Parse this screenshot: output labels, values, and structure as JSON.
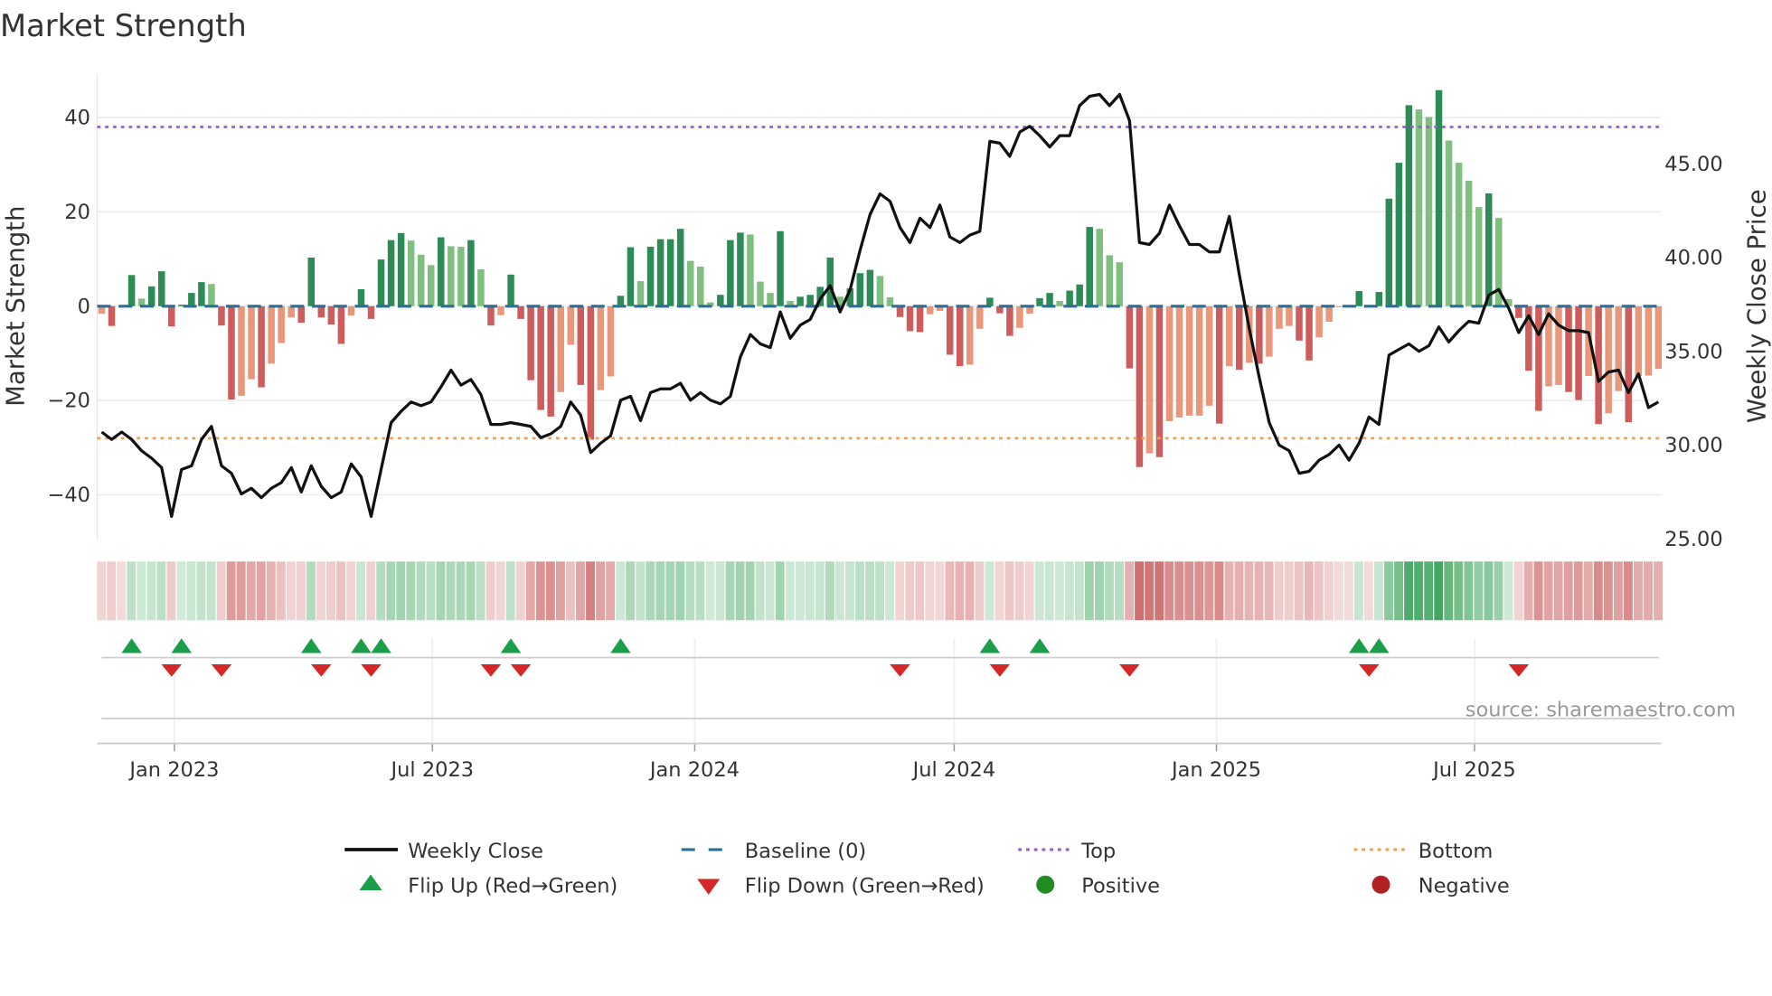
{
  "title": "Market Strength",
  "source": "source: sharemaestro.com",
  "legend": {
    "weekly_close": "Weekly Close",
    "baseline": "Baseline (0)",
    "top": "Top",
    "bottom": "Bottom",
    "flip_up": "Flip Up (Red→Green)",
    "flip_down": "Flip Down (Green→Red)",
    "positive": "Positive",
    "negative": "Negative"
  },
  "colors": {
    "pos_rising": "#2e8b57",
    "pos_falling": "#7fbf7f",
    "neg_falling": "#cd5c5c",
    "neg_rising": "#e9967a",
    "baseline": "#2a6f97",
    "top": "#9b59d6",
    "bottom": "#f0a050",
    "close": "#111111",
    "flip_up": "#1a9e4a",
    "flip_down": "#d62728",
    "positive": "#228b22",
    "negative": "#b22222"
  },
  "chart_data": {
    "type": "bar+line",
    "title": "Market Strength",
    "ylabel_left": "Market Strength",
    "ylabel_right": "Weekly Close Price",
    "ylim_left": [
      -49.5,
      49.5
    ],
    "ylim_right": [
      24.9,
      49.8
    ],
    "left_ticks": [
      {
        "v": 40,
        "label": "40"
      },
      {
        "v": 20,
        "label": "20"
      },
      {
        "v": 0,
        "label": "0"
      },
      {
        "v": -20,
        "label": "−20"
      },
      {
        "v": -40,
        "label": "−40"
      }
    ],
    "right_ticks": [
      {
        "v": 45,
        "label": "45.00"
      },
      {
        "v": 40,
        "label": "40.00"
      },
      {
        "v": 35,
        "label": "35.00"
      },
      {
        "v": 30,
        "label": "30.00"
      },
      {
        "v": 25,
        "label": "25.00"
      }
    ],
    "x_start_week": "2022-11-11",
    "x_ticks": [
      {
        "date": "2023-01-01",
        "label": "Jan 2023"
      },
      {
        "date": "2023-07-01",
        "label": "Jul 2023"
      },
      {
        "date": "2024-01-01",
        "label": "Jan 2024"
      },
      {
        "date": "2024-07-01",
        "label": "Jul 2024"
      },
      {
        "date": "2025-01-01",
        "label": "Jan 2025"
      },
      {
        "date": "2025-07-01",
        "label": "Jul 2025"
      }
    ],
    "top_level": 38,
    "bottom_level": -28,
    "baseline": 0,
    "grid": true,
    "legend_position": "bottom",
    "strength": [
      -1.6,
      -4.2,
      -0.2,
      6.6,
      1.6,
      4.2,
      7.4,
      -4.3,
      0.3,
      2.8,
      5.1,
      4.7,
      -4.1,
      -19.8,
      -19.0,
      -15.5,
      -17.2,
      -12.2,
      -7.8,
      -2.4,
      -3.5,
      10.3,
      -2.4,
      -3.9,
      -8.0,
      -2.0,
      3.6,
      -2.7,
      9.9,
      14.0,
      15.5,
      13.9,
      10.9,
      8.7,
      14.6,
      12.7,
      12.6,
      14.0,
      7.8,
      -4.1,
      -1.9,
      6.7,
      -2.7,
      -15.7,
      -22.0,
      -23.4,
      -18.2,
      -8.2,
      -16.7,
      -28.3,
      -17.8,
      -14.9,
      2.2,
      12.5,
      5.3,
      12.6,
      14.2,
      14.2,
      16.4,
      9.6,
      8.4,
      0.8,
      2.4,
      14.0,
      15.6,
      15.2,
      5.2,
      2.8,
      15.9,
      1.1,
      2.0,
      2.4,
      4.1,
      10.3,
      2.0,
      3.8,
      7.0,
      7.7,
      6.4,
      1.9,
      -2.3,
      -5.3,
      -5.5,
      -1.7,
      -1.0,
      -10.3,
      -12.7,
      -12.4,
      -4.8,
      1.8,
      -1.5,
      -6.3,
      -4.6,
      -1.6,
      1.7,
      2.8,
      1.1,
      3.3,
      4.6,
      16.8,
      16.4,
      10.8,
      9.3,
      -13.2,
      -34.1,
      -31.2,
      -32.0,
      -24.4,
      -23.6,
      -23.2,
      -23.2,
      -21.1,
      -24.9,
      -12.7,
      -13.5,
      -12.0,
      -12.2,
      -10.7,
      -4.8,
      -4.2,
      -7.3,
      -11.5,
      -6.6,
      -3.3,
      -0.2,
      -0.1,
      3.2,
      -0.1,
      3.0,
      22.8,
      30.4,
      42.6,
      41.7,
      40.1,
      45.8,
      35.1,
      30.4,
      26.6,
      21.0,
      23.9,
      18.7,
      1.5,
      -2.5,
      -13.7,
      -22.2,
      -17.0,
      -16.7,
      -18.2,
      -19.9,
      -14.8,
      -25.0,
      -22.7,
      -18.0,
      -24.6,
      -14.8,
      -14.7,
      -13.3
    ],
    "weekly_close": [
      30.7,
      30.3,
      30.7,
      30.3,
      29.7,
      29.3,
      28.8,
      26.2,
      28.7,
      28.9,
      30.3,
      31.0,
      28.9,
      28.5,
      27.4,
      27.7,
      27.2,
      27.7,
      28.0,
      28.8,
      27.5,
      28.9,
      27.8,
      27.2,
      27.5,
      29.0,
      28.3,
      26.2,
      28.7,
      31.2,
      31.8,
      32.3,
      32.1,
      32.3,
      33.1,
      34.0,
      33.2,
      33.5,
      32.7,
      31.1,
      31.1,
      31.2,
      31.1,
      31.0,
      30.4,
      30.6,
      31.0,
      32.3,
      31.6,
      29.6,
      30.1,
      30.5,
      32.4,
      32.6,
      31.3,
      32.8,
      33.0,
      33.0,
      33.3,
      32.4,
      32.8,
      32.4,
      32.2,
      32.6,
      34.7,
      35.9,
      35.4,
      35.2,
      37.1,
      35.7,
      36.4,
      36.7,
      37.8,
      38.5,
      37.1,
      38.3,
      40.4,
      42.3,
      43.4,
      43.0,
      41.6,
      40.8,
      42.1,
      41.6,
      42.8,
      41.1,
      40.8,
      41.2,
      41.4,
      46.2,
      46.1,
      45.4,
      46.7,
      47.0,
      46.5,
      45.9,
      46.5,
      46.5,
      48.1,
      48.6,
      48.7,
      48.1,
      48.7,
      47.3,
      40.8,
      40.7,
      41.3,
      42.8,
      41.7,
      40.7,
      40.7,
      40.3,
      40.3,
      42.2,
      39.1,
      36.2,
      33.6,
      31.2,
      30.0,
      29.7,
      28.5,
      28.6,
      29.2,
      29.5,
      30.0,
      29.2,
      30.1,
      31.5,
      31.1,
      34.8,
      35.1,
      35.4,
      35.0,
      35.3,
      36.3,
      35.5,
      36.1,
      36.6,
      36.5,
      38.0,
      38.3,
      37.3,
      36.0,
      36.9,
      35.9,
      37.0,
      36.4,
      36.1,
      36.1,
      36.0,
      33.4,
      33.9,
      34.0,
      32.8,
      33.8,
      32.0,
      32.3
    ]
  }
}
